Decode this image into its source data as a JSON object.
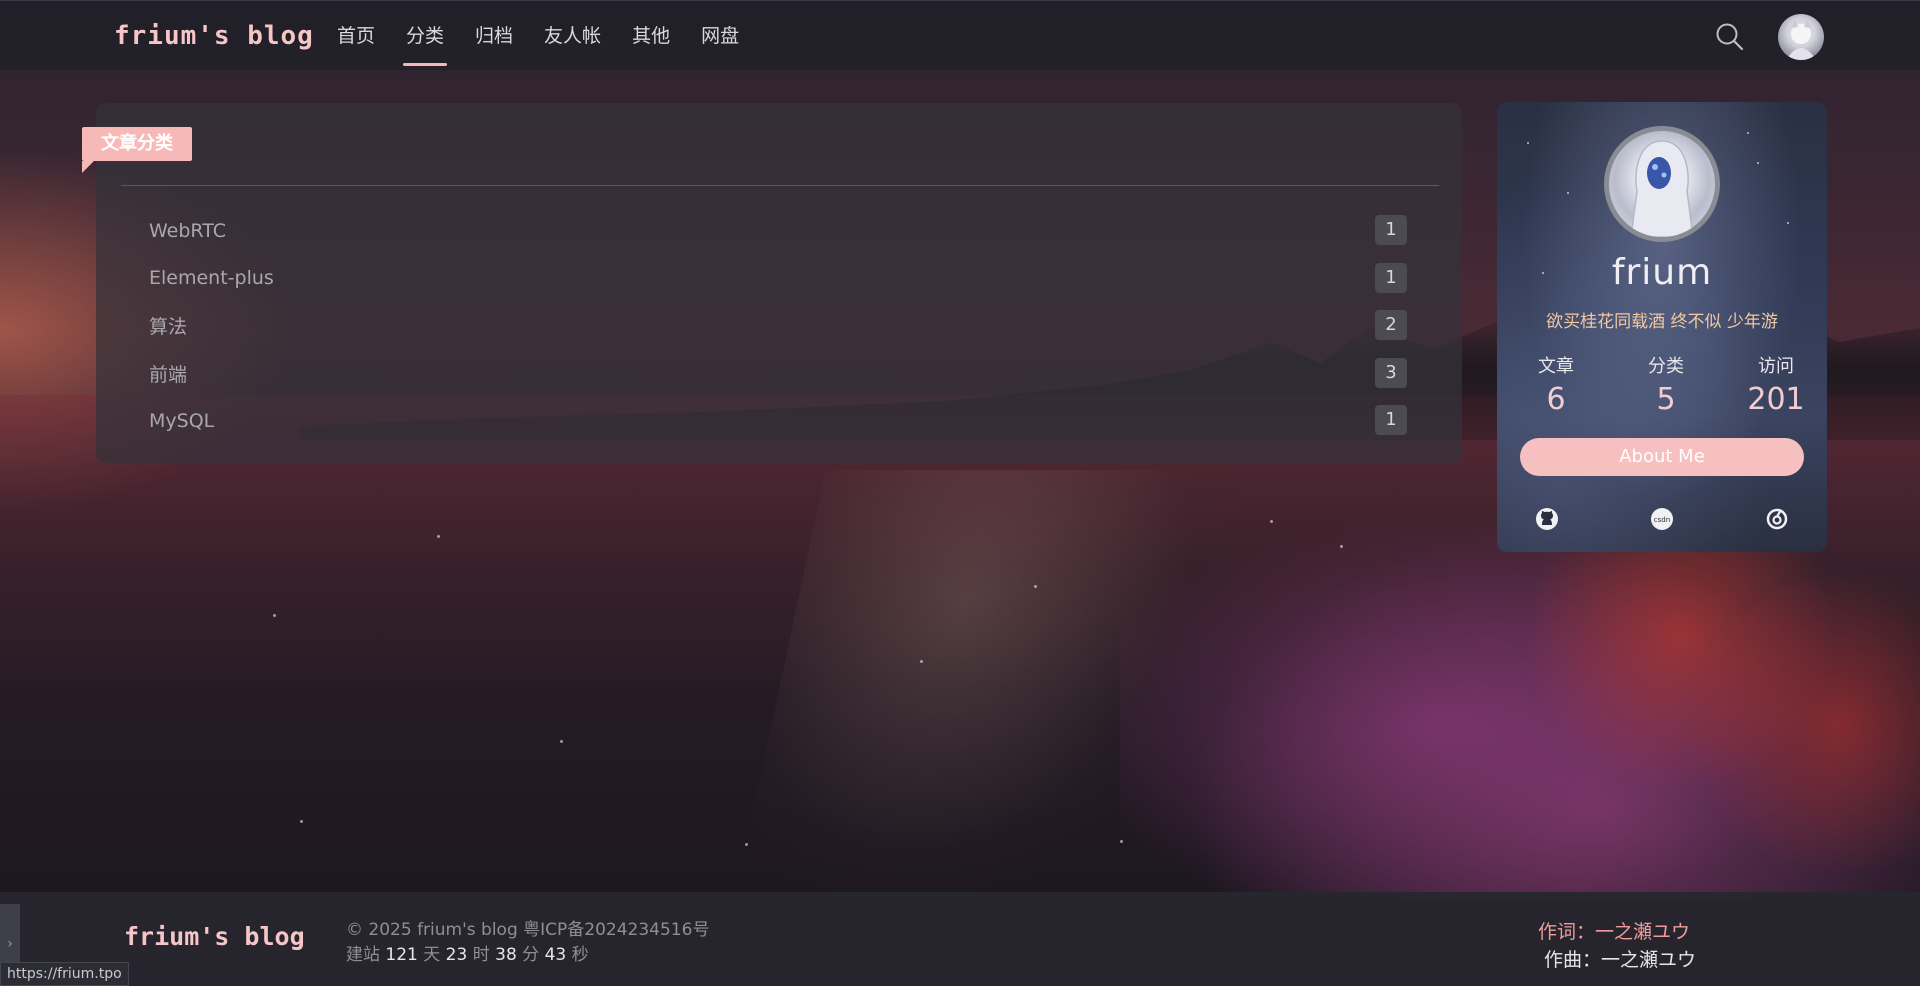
{
  "site": {
    "brand": "frium's blog"
  },
  "nav": {
    "items": [
      {
        "label": "首页",
        "active": false
      },
      {
        "label": "分类",
        "active": true
      },
      {
        "label": "归档",
        "active": false
      },
      {
        "label": "友人帐",
        "active": false
      },
      {
        "label": "其他",
        "active": false
      },
      {
        "label": "网盘",
        "active": false
      }
    ],
    "search_icon": "search-icon",
    "avatar_icon": "user-avatar"
  },
  "categories": {
    "tag_label": "文章分类",
    "items": [
      {
        "name": "WebRTC",
        "count": "1"
      },
      {
        "name": "Element-plus",
        "count": "1"
      },
      {
        "name": "算法",
        "count": "2"
      },
      {
        "name": "前端",
        "count": "3"
      },
      {
        "name": "MySQL",
        "count": "1"
      }
    ]
  },
  "profile": {
    "name": "frium",
    "motto": "欲买桂花同载酒 终不似 少年游",
    "stats": [
      {
        "label": "文章",
        "value": "6"
      },
      {
        "label": "分类",
        "value": "5"
      },
      {
        "label": "访问",
        "value": "201"
      }
    ],
    "about_button": "About Me",
    "socials": [
      "github-icon",
      "csdn-icon",
      "gitee-icon"
    ],
    "csdn_text": "csdn"
  },
  "footer": {
    "brand": "frium's blog",
    "copyright": "© 2025 frium's blog 粤ICP备2024234516号",
    "runtime": {
      "prefix": "建站",
      "days": "121",
      "days_unit": "天",
      "hours": "23",
      "hours_unit": "时",
      "minutes": "38",
      "minutes_unit": "分",
      "seconds": "43",
      "seconds_unit": "秒"
    },
    "lyricist": "作词：一之瀬ユウ",
    "composer": "作曲：一之瀬ユウ",
    "side_toggle": "›"
  },
  "status_bar": {
    "url": "https://frium.tpo"
  },
  "colors": {
    "accent": "#f7b8b8",
    "motto": "#f2c9a0",
    "lyric": "#ef9b9b"
  }
}
